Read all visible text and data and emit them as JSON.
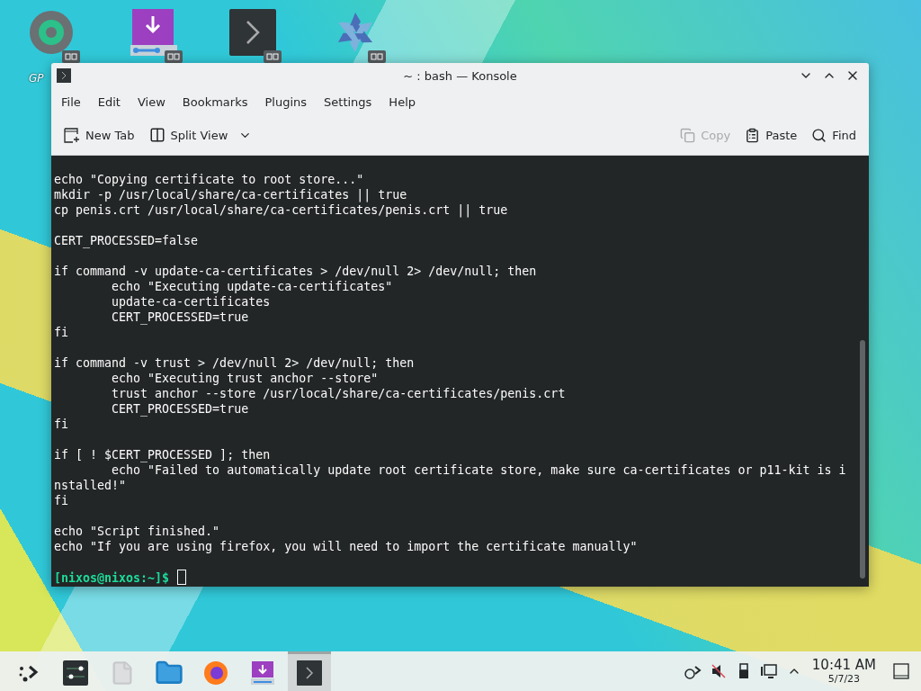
{
  "desktop_icons": [
    {
      "kind": "gparted",
      "label": "GP"
    },
    {
      "kind": "installer"
    },
    {
      "kind": "konsole"
    },
    {
      "kind": "nixos"
    }
  ],
  "window": {
    "title": "~ : bash — Konsole"
  },
  "menu": [
    "File",
    "Edit",
    "View",
    "Bookmarks",
    "Plugins",
    "Settings",
    "Help"
  ],
  "toolbar": [
    {
      "kind": "new-tab",
      "label": "New Tab",
      "disabled": false
    },
    {
      "kind": "split-view",
      "label": "Split View",
      "disabled": false
    },
    {
      "kind": "copy",
      "label": "Copy",
      "disabled": true
    },
    {
      "kind": "paste",
      "label": "Paste",
      "disabled": false
    },
    {
      "kind": "find",
      "label": "Find",
      "disabled": false
    }
  ],
  "terminal": {
    "lines": [
      {
        "kind": "text",
        "text": "echo \"Copying certificate to root store...\""
      },
      {
        "kind": "text",
        "text": "mkdir -p /usr/local/share/ca-certificates || true"
      },
      {
        "kind": "text",
        "text": "cp penis.crt /usr/local/share/ca-certificates/penis.crt || true"
      },
      {
        "kind": "blank"
      },
      {
        "kind": "text",
        "text": "CERT_PROCESSED=false"
      },
      {
        "kind": "blank"
      },
      {
        "kind": "text",
        "text": "if command -v update-ca-certificates > /dev/null 2> /dev/null; then"
      },
      {
        "kind": "text",
        "text": "        echo \"Executing update-ca-certificates\""
      },
      {
        "kind": "text",
        "text": "        update-ca-certificates"
      },
      {
        "kind": "text",
        "text": "        CERT_PROCESSED=true"
      },
      {
        "kind": "text",
        "text": "fi"
      },
      {
        "kind": "blank"
      },
      {
        "kind": "text",
        "text": "if command -v trust > /dev/null 2> /dev/null; then"
      },
      {
        "kind": "text",
        "text": "        echo \"Executing trust anchor --store\""
      },
      {
        "kind": "text",
        "text": "        trust anchor --store /usr/local/share/ca-certificates/penis.crt"
      },
      {
        "kind": "text",
        "text": "        CERT_PROCESSED=true"
      },
      {
        "kind": "text",
        "text": "fi"
      },
      {
        "kind": "blank"
      },
      {
        "kind": "text",
        "text": "if [ ! $CERT_PROCESSED ]; then"
      },
      {
        "kind": "text",
        "text": "        echo \"Failed to automatically update root certificate store, make sure ca-certificates or p11-kit is i"
      },
      {
        "kind": "text",
        "text": "nstalled!\""
      },
      {
        "kind": "text",
        "text": "fi"
      },
      {
        "kind": "blank"
      },
      {
        "kind": "text",
        "text": "echo \"Script finished.\""
      },
      {
        "kind": "text",
        "text": "echo \"If you are using firefox, you will need to import the certificate manually\""
      },
      {
        "kind": "blank"
      },
      {
        "kind": "prompt",
        "text": "[nixos@nixos:~]$"
      }
    ]
  },
  "taskbar": {
    "items": [
      {
        "kind": "launcher",
        "selected": false
      },
      {
        "kind": "settings",
        "selected": false
      },
      {
        "kind": "file",
        "selected": false
      },
      {
        "kind": "folder",
        "selected": false
      },
      {
        "kind": "firefox",
        "selected": false
      },
      {
        "kind": "installer",
        "selected": false
      },
      {
        "kind": "konsole",
        "selected": true
      }
    ],
    "tray": [
      {
        "kind": "network"
      },
      {
        "kind": "muted"
      },
      {
        "kind": "usb"
      },
      {
        "kind": "display"
      },
      {
        "kind": "expand"
      }
    ],
    "time": "10:41 AM",
    "date": "5/7/23"
  }
}
